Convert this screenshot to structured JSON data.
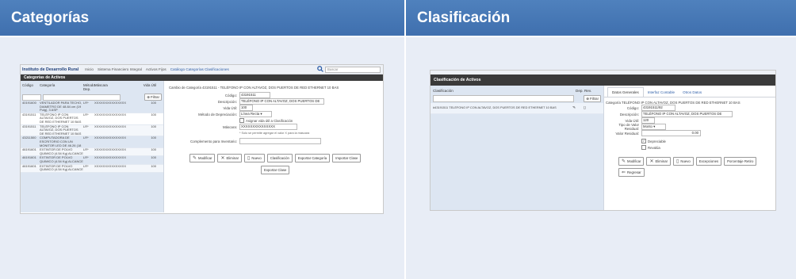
{
  "slides": {
    "left_title": "Categorías",
    "right_title": "Clasificación"
  },
  "colors": {
    "header": "#4f81bd",
    "panel": "#e8edf6",
    "darkbar": "#3a3a3a",
    "link": "#2f5fa8"
  },
  "categorias": {
    "institution": "Instituto de Desarrollo Rural",
    "nav": [
      "Inicio",
      "Sistema Financiero Integral",
      "Activos Fijos",
      "Catálogo Categorías Clasificaciones"
    ],
    "search_placeholder": "Buscar",
    "panel_title": "Categorías de Activos",
    "columns": {
      "code": "Código",
      "category": "Categoría",
      "method": "Método Dep.",
      "mask": "Máscara",
      "life": "Vida Útil"
    },
    "filter_label": "Filtrar",
    "rows": [
      {
        "code": "40191600",
        "category": "VENTILADOR PARA TECHO, DIAMETRO DE 48.84 cm (19 Pulg), 3 ASP",
        "method": "LR*",
        "mask": "XXXXXXXXXXXXXXX",
        "life": "100"
      },
      {
        "code": "43191511",
        "category": "TELÉFONO IP CON ALTAVOZ, DOS PUERTOS DE RED ETHERNET 10 BAS",
        "method": "LR*",
        "mask": "XXXXXXXXXXXXXXX",
        "life": "100"
      },
      {
        "code": "43191511",
        "category": "TELÉFONO IP CON ALTAVOZ, DOS PUERTOS DE RED ETHERNET 10 BAS",
        "method": "LR*",
        "mask": "XXXXXXXXXXXXXXX",
        "life": "100"
      },
      {
        "code": "43211500",
        "category": "COMPUTADORA DE ESCRITORIO CON UN MONITOR LED DE 46.26 (18 Pu",
        "method": "LR*",
        "mask": "XXXXXXXXXXXXXXX",
        "life": "100"
      },
      {
        "code": "46191601",
        "category": "EXTINTOR DE POLVO QUIMICO (4.54 Kg) ALCANCE DE 4.6 A 6.4 m A",
        "method": "LR*",
        "mask": "XXXXXXXXXXXXXXX",
        "life": "100"
      },
      {
        "code": "46191601",
        "category": "EXTINTOR DE POLVO QUIMICO (4.54 Kg) ALCANCE DE 4.6 A 6.4 m A",
        "method": "LR*",
        "mask": "XXXXXXXXXXXXXXX",
        "life": "100"
      },
      {
        "code": "46191601",
        "category": "EXTINTOR DE POLVO QUIMICO (4.54 Kg) ALCANCE DE 4.6 A 6.4 m A",
        "method": "LR*",
        "mask": "XXXXXXXXXXXXXXX",
        "life": "100"
      }
    ],
    "form": {
      "title": "Cambio de Categoría 43191511 - TELÉFONO IP CON ALTAVOZ, DOS PUERTOS DE RED ETHERNET 10 BAS",
      "code_label": "Código:",
      "code_value": "43191511",
      "desc_label": "Descripción:",
      "desc_value": "TELÉFONO IP CON ALTAVOZ, DOS PUERTOS DE",
      "life_label": "Vida Útil:",
      "life_value": "100",
      "method_label": "Método de Depreciación:",
      "method_value": "Línea Recta",
      "checkbox_label": "Asignar vida útil a Clasificación",
      "mask_label": "Máscara:",
      "mask_value": "XXXXXXXXXXXXXXX",
      "mask_hint": "* Solo se permite agregar el valor X para la máscara",
      "complement_label": "Complemento para Inventario:"
    },
    "buttons": [
      "Modificar",
      "Eliminar",
      "Nuevo",
      "Clasificación",
      "Exportar Categoría",
      "Importar Clase",
      "Exportar Clase"
    ]
  },
  "clasificacion": {
    "panel_title": "Clasificación de Activos",
    "columns": {
      "classification": "Clasificación",
      "dep": "Dep. Rev."
    },
    "filter_label": "Filtrar",
    "row": {
      "text": "#43191511 TELÉFONO IP CON ALTAVOZ, DOS PUERTOS DE RED ETHERNET 10 BAS"
    },
    "tabs": [
      "Datos Generales",
      "Interfaz Contable",
      "Otros Datos"
    ],
    "form": {
      "title": "Categoría TELÉFONO IP CON ALTAVOZ, DOS PUERTOS DE RED ETHERNET 10 BAS",
      "code_label": "Código:",
      "code_value": "43191511/92",
      "desc_label": "Descripción:",
      "desc_value": "TELÉFONO IP CON ALTAVOZ, DOS PUERTOS DE",
      "life_label": "Vida Útil:",
      "life_value": "120",
      "residual_type_label": "Tipo de Valor Residual:",
      "residual_type_value": "Monto",
      "residual_label": "Valor Residual:",
      "residual_value": "0.00",
      "depreciable_label": "Depreciable",
      "revaluation_label": "Revalúa"
    },
    "buttons": [
      "Modificar",
      "Eliminar",
      "Nuevo",
      "Excepciones",
      "Porcentaje Retiro",
      "Regresar"
    ]
  }
}
